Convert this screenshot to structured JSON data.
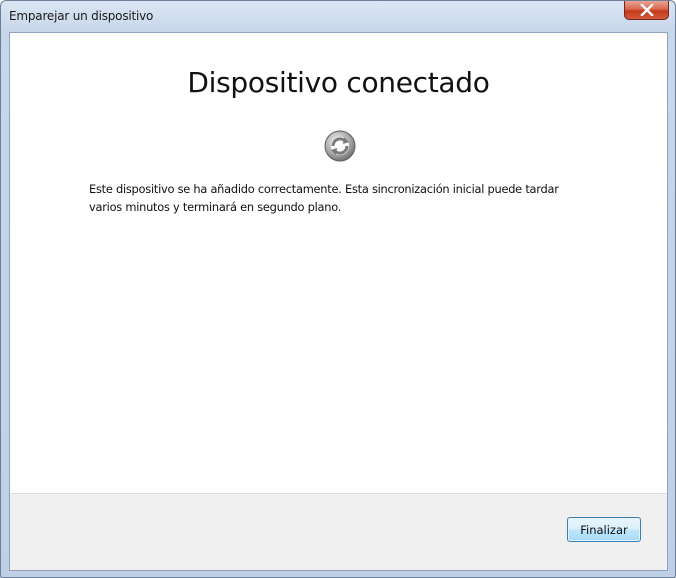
{
  "window": {
    "title": "Emparejar un dispositivo",
    "close_icon": "close-icon"
  },
  "content": {
    "heading": "Dispositivo conectado",
    "icon": "sync-icon",
    "message": "Este dispositivo se ha añadido correctamente. Esta sincronización inicial puede tardar varios minutos y terminará en segundo plano."
  },
  "footer": {
    "finish_label": "Finalizar"
  },
  "colors": {
    "close_button": "#c4391c",
    "button_border": "#3c7fb1",
    "footer_background": "#f0f0f0"
  }
}
